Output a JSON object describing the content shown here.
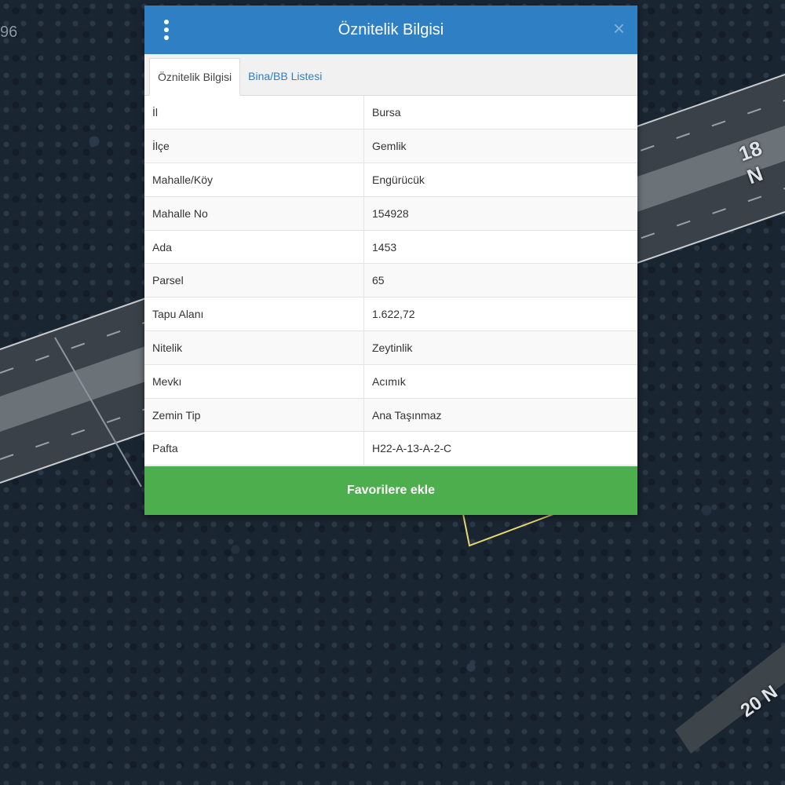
{
  "map": {
    "coord_label": "96",
    "road_labels": [
      "18 N",
      "20 N"
    ]
  },
  "panel": {
    "title": "Öznitelik Bilgisi",
    "tabs": [
      {
        "label": "Öznitelik Bilgisi",
        "active": true
      },
      {
        "label": "Bina/BB Listesi",
        "active": false
      }
    ],
    "rows": [
      {
        "key": "İl",
        "value": "Bursa"
      },
      {
        "key": "İlçe",
        "value": "Gemlik"
      },
      {
        "key": "Mahalle/Köy",
        "value": "Engürücük"
      },
      {
        "key": "Mahalle No",
        "value": "154928"
      },
      {
        "key": "Ada",
        "value": "1453"
      },
      {
        "key": "Parsel",
        "value": "65"
      },
      {
        "key": "Tapu Alanı",
        "value": "1.622,72"
      },
      {
        "key": "Nitelik",
        "value": "Zeytinlik"
      },
      {
        "key": "Mevkı",
        "value": "Acımık"
      },
      {
        "key": "Zemin Tip",
        "value": "Ana Taşınmaz"
      },
      {
        "key": "Pafta",
        "value": "H22-A-13-A-2-C"
      }
    ],
    "favorite_button": "Favorilere ekle"
  },
  "colors": {
    "header": "#2f7fc4",
    "button": "#4cae4c",
    "parcel_outline": "#e8d870"
  }
}
